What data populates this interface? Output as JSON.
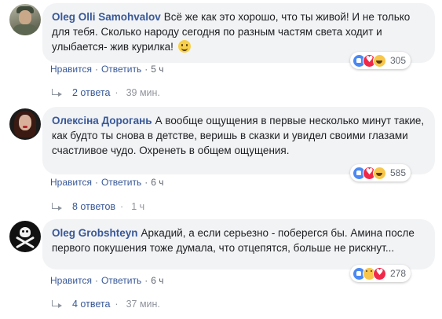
{
  "comments": [
    {
      "author": "Oleg Olli Samohvalov",
      "text": "Всё же как это хорошо, что ты живой! И не только для тебя. Сколько народу сегодня по разным частям света ходит и улыбается- жив курилка!",
      "emoji": "slightly-smiling-face-emoji",
      "reactions": [
        "like",
        "love",
        "haha"
      ],
      "reaction_count": "305",
      "actions": {
        "like": "Нравится",
        "reply": "Ответить",
        "time": "5 ч"
      },
      "replies": {
        "label": "2 ответа",
        "time": "39 мин."
      }
    },
    {
      "author": "Олексіна Дорогань",
      "text": "А вообще ощущения в первые несколько минут такие, как будто ты снова в детстве, веришь в сказки и увидел своими глазами счастливое чудо. Охренеть в общем ощущения.",
      "reactions": [
        "like",
        "love",
        "haha"
      ],
      "reaction_count": "585",
      "actions": {
        "like": "Нравится",
        "reply": "Ответить",
        "time": "6 ч"
      },
      "replies": {
        "label": "8 ответов",
        "time": "1 ч"
      }
    },
    {
      "author": "Oleg Grobshteyn",
      "text": "Аркадий, а если серьезно - поберегся бы. Амина после первого покушения тоже думала, что отцепятся, больше не рискнут...",
      "reactions": [
        "like",
        "sad",
        "love"
      ],
      "reaction_count": "278",
      "actions": {
        "like": "Нравится",
        "reply": "Ответить",
        "time": "6 ч"
      },
      "replies": {
        "label": "4 ответа",
        "time": "37 мин."
      }
    }
  ],
  "colors": {
    "link": "#385898",
    "bubble": "#f2f3f5",
    "meta": "#616770"
  },
  "icons": [
    "like-reaction-icon",
    "love-reaction-icon",
    "haha-reaction-icon",
    "sad-reaction-icon",
    "reply-arrow-icon"
  ]
}
